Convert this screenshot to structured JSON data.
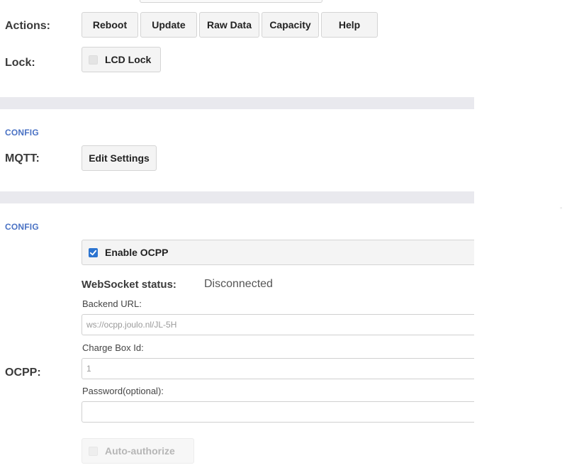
{
  "actions": {
    "label": "Actions:",
    "buttons": [
      "Reboot",
      "Update",
      "Raw Data",
      "Capacity",
      "Help"
    ]
  },
  "lock": {
    "label": "Lock:",
    "checkbox_label": "LCD Lock",
    "checked": false
  },
  "mqtt_section": {
    "section_label": "CONFIG",
    "label": "MQTT:",
    "button": "Edit Settings"
  },
  "ocpp_section": {
    "section_label": "CONFIG",
    "label": "OCPP:",
    "enable_label": "Enable OCPP",
    "enable_checked": true,
    "websocket_status_label": "WebSocket status:",
    "websocket_status_value": "Disconnected",
    "backend_url_label": "Backend URL:",
    "backend_url_value": "ws://ocpp.joulo.nl/JL-5H",
    "charge_box_label": "Charge Box Id:",
    "charge_box_value": "1",
    "password_label": "Password(optional):",
    "password_value": "",
    "auto_authorize_label": "Auto-authorize",
    "auto_authorize_checked": false
  },
  "colors": {
    "section_label": "#4a72c4",
    "checkbox_checked": "#2c74d0",
    "section_bar": "#e9e9ee"
  }
}
